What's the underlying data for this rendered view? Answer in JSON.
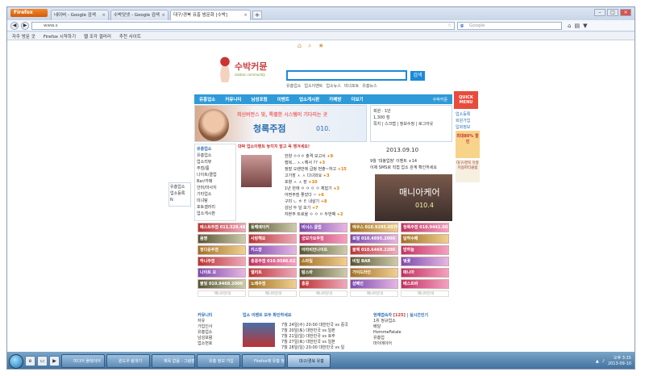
{
  "browser": {
    "menu_button": "Firefox",
    "tabs": [
      {
        "label": "네이버 - Google 검색",
        "active": false
      },
      {
        "label": "수박닷넷 - Google 검색",
        "active": false
      },
      {
        "label": "대구/경북 유흥 밤문화 [수박]",
        "active": true
      }
    ],
    "new_tab": "+",
    "url": "www.s",
    "search_placeholder": "Google",
    "bookmarks": [
      "자주 방문 곳",
      "Firefox 시작하기",
      "웹 조각 갤러리",
      "추천 사이트"
    ]
  },
  "site": {
    "logo_title": "수박커뮨",
    "logo_sub": "soobac community",
    "search_button": "검색",
    "search_links": [
      "유흥업소",
      "업소이벤트",
      "업소뉴스",
      "미녀포토",
      "유흥뉴스"
    ],
    "nav": [
      "유흥업소",
      "커뮤니티",
      "남성포럼",
      "이벤트",
      "업소게시판",
      "카페방",
      "더보기"
    ],
    "nav_right": "수박커뮨",
    "banner_tagline": "최신버전스 맞, 특별한 시스템이 기다리는 곳",
    "banner_name": "청록주점",
    "banner_phone": "010.",
    "login": {
      "user": "회원",
      "level": "1단",
      "points": "1,300 점",
      "links": "쪽지 | 스크랩 | 정보수정 | 로그아웃"
    },
    "side_menu": {
      "title": "유흥업소",
      "items": [
        "유흥업소",
        "업소리뷰",
        "주점/룸",
        "나이트/클럽",
        "Bar/카페",
        "안마/마사지",
        "기타업소",
        "미녀탐",
        "포토갤러리",
        "업소게시판"
      ]
    },
    "event_header": "대박 업소이벤트 놓치지 말고 꼭 챙겨세요!",
    "event_items": [
      {
        "text": "한양 ㅇㅇㅇ 출격 보고서",
        "n": "+9"
      },
      {
        "text": "행복... ㅅㅅ해서 ??",
        "n": "+3"
      },
      {
        "text": "정말 오랜만에 급벙 번출~하고",
        "n": "+15"
      },
      {
        "text": "고가장 ㅅ ㅅ 다녀와요",
        "n": "+3"
      },
      {
        "text": "포항 ㅅ ㅅ 장",
        "n": "+10"
      },
      {
        "text": "1년 만에 ㅇ ㅇ ㅇ ㅇ 체험기",
        "n": "+3"
      },
      {
        "text": "어쩐주점 좋았다 ~",
        "n": "+6"
      },
      {
        "text": "구미 ㄴ ㅎ ㅌ 내살기",
        "n": "+8"
      },
      {
        "text": "강남 두 달 보기",
        "n": "+7"
      },
      {
        "text": "자본주 트로울 ㅇ ㅇ ㅇ 두번째",
        "n": "+2"
      }
    ],
    "side_widget": [
      "유흥업소",
      "업소등록",
      "N"
    ],
    "date": "2013.09.10",
    "news_items": [
      "9월 '대봉업청' 이벤트 +14",
      "이제 SMS로 직접 업소 관계 확인하세요"
    ],
    "promo_title": "매니아케어",
    "promo_phone": "010.4",
    "side_ad1": "QUICK MENU",
    "side_links": [
      "업소등록",
      "회원가입",
      "입회정보"
    ],
    "side_ad2": "최대80% 할인",
    "side_ad3": "대구/경북 유흥 미용파티클럽"
  },
  "ads": [
    "베스트주점 011.528.4848",
    "동해메이커",
    "비너스 클럽",
    "에쿠스 010.9285.6976",
    "청록주점 010.9442.0020",
    "몸짱",
    "사랑해요",
    "궁모가요주점",
    "로열 010.4895.2000",
    "달하수페",
    "정다운주점",
    "키스방",
    "아라비안나이트",
    "블랙 010.6469.2200",
    "밤하늘",
    "하니주점",
    "홍콩주점 010.9586.6222",
    "스마일",
    "비밀 BAR",
    "벚꽃",
    "나이트 오",
    "엘리트",
    "탐스바",
    "가이드라인",
    "매니아",
    "불빛 010.9468.2000",
    "노래주점",
    "홍콩",
    "샴페인",
    "베스트바"
  ],
  "ad_labels": [
    "매니아문의",
    "매니아문의",
    "매니아문의",
    "매니아문의",
    "매니아문의"
  ],
  "bottom": {
    "community_title": "커뮤니티",
    "community_items": [
      "자유",
      "가입인사",
      "유흥업소",
      "남성포럼",
      "업소번호"
    ],
    "news_title": "업소 이벤트 모두 확인하세요",
    "news_items": [
      "7월 24일(수) 20:00 대한민국 vs 중국",
      "7월 20일(토) 대한민국 vs 일본",
      "7월 21일(일) 대한민국 vs 호주",
      "7월 27일(토) 대한민국 vs 일본",
      "7월 28일(일) 20:00 대한민국 vs 일"
    ],
    "rank_title": "현재접속자",
    "rank_count": "[125]",
    "rank_tab": "실시간인기",
    "rank_items": [
      "1위 정규업소",
      "배달",
      "HommeFatale",
      "유흥업",
      "마이에이어"
    ]
  },
  "taskbar": {
    "buttons": [
      "미디어 플레이어",
      "윈도우 탐색기",
      "제목 없음 - 그림판",
      "유흥 정보 가입",
      "Firefox에 유흥 정보",
      "대구/경북 유흥"
    ],
    "time": "오후 3:15",
    "date": "2013-09-10"
  }
}
